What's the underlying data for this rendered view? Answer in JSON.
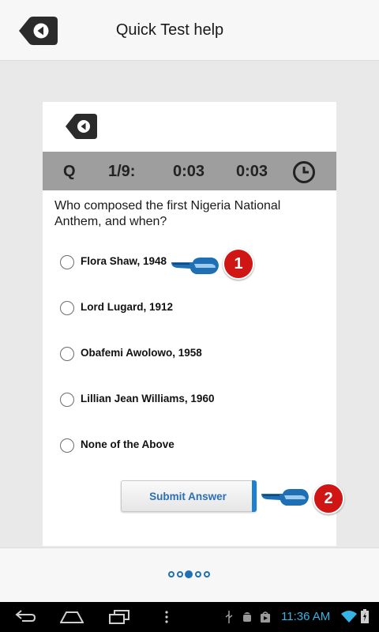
{
  "header": {
    "title": "Quick Test help",
    "back_icon": "back-arrow-icon"
  },
  "quiz": {
    "q_label": "Q",
    "counter": "1/9:",
    "time_elapsed": "0:03",
    "time_total": "0:03",
    "question": "Who composed the first Nigeria National Anthem, and when?",
    "options": [
      "Flora Shaw, 1948",
      "Lord Lugard, 1912",
      "Obafemi Awolowo, 1958",
      "Lillian Jean Williams, 1960",
      "None of the Above"
    ],
    "submit_label": "Submit Answer"
  },
  "annotations": {
    "badge1": "1",
    "badge2": "2"
  },
  "pager": {
    "count": 5,
    "active_index": 2
  },
  "status": {
    "time": "11:36 AM"
  },
  "colors": {
    "accent": "#1f6fb4",
    "badge": "#d01515",
    "question_bar": "#9e9e9e",
    "status_time": "#33b5e5"
  }
}
